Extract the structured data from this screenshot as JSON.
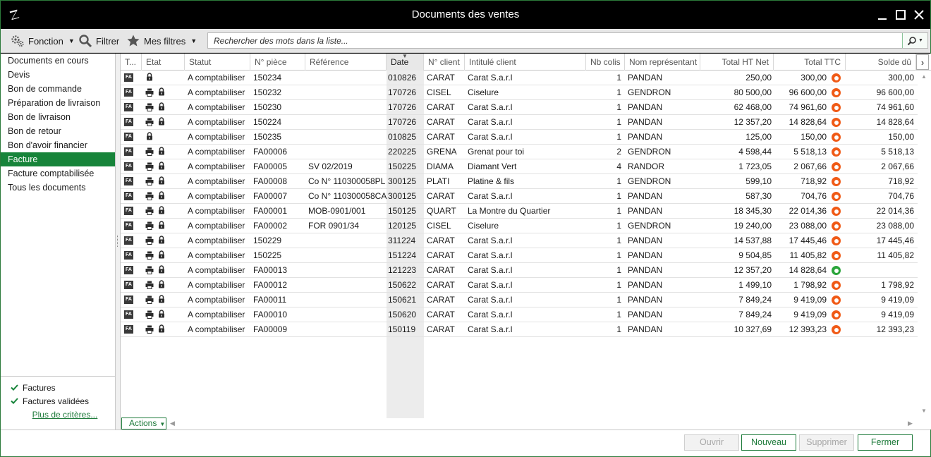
{
  "window": {
    "title": "Documents des ventes"
  },
  "toolbar": {
    "fonction_label": "Fonction",
    "filtrer_label": "Filtrer",
    "mes_filtres_label": "Mes filtres",
    "search_placeholder": "Rechercher des mots dans la liste..."
  },
  "sidebar": {
    "items": [
      {
        "label": "Documents en cours",
        "active": false
      },
      {
        "label": "Devis",
        "active": false
      },
      {
        "label": "Bon de commande",
        "active": false
      },
      {
        "label": "Préparation de livraison",
        "active": false
      },
      {
        "label": "Bon de livraison",
        "active": false
      },
      {
        "label": "Bon de retour",
        "active": false
      },
      {
        "label": "Bon d'avoir financier",
        "active": false
      },
      {
        "label": "Facture",
        "active": true
      },
      {
        "label": "Facture comptabilisée",
        "active": false
      },
      {
        "label": "Tous les documents",
        "active": false
      }
    ],
    "filters": [
      {
        "label": "Factures",
        "checked": true
      },
      {
        "label": "Factures validées",
        "checked": true
      }
    ],
    "more_criteria": "Plus de critères..."
  },
  "grid": {
    "columns": [
      "T...",
      "Etat",
      "Statut",
      "N° pièce",
      "Référence",
      "Date",
      "N° client",
      "Intitulé client",
      "Nb colis",
      "Nom représentant",
      "Total HT Net",
      "Total TTC",
      "Solde dû"
    ],
    "type_badge": "FA",
    "rows": [
      {
        "printed": false,
        "statut": "A comptabiliser",
        "piece": "150234",
        "ref": "",
        "date": "010826",
        "client": "CARAT",
        "intitule": "Carat S.a.r.l",
        "colis": "1",
        "rep": "PANDAN",
        "ht": "250,00",
        "ttc": "300,00",
        "status": "orange",
        "solde": "300,00"
      },
      {
        "printed": true,
        "statut": "A comptabiliser",
        "piece": "150232",
        "ref": "",
        "date": "170726",
        "client": "CISEL",
        "intitule": "Ciselure",
        "colis": "1",
        "rep": "GENDRON",
        "ht": "80 500,00",
        "ttc": "96 600,00",
        "status": "orange",
        "solde": "96 600,00"
      },
      {
        "printed": true,
        "statut": "A comptabiliser",
        "piece": "150230",
        "ref": "",
        "date": "170726",
        "client": "CARAT",
        "intitule": "Carat S.a.r.l",
        "colis": "1",
        "rep": "PANDAN",
        "ht": "62 468,00",
        "ttc": "74 961,60",
        "status": "orange",
        "solde": "74 961,60"
      },
      {
        "printed": true,
        "statut": "A comptabiliser",
        "piece": "150224",
        "ref": "",
        "date": "170726",
        "client": "CARAT",
        "intitule": "Carat S.a.r.l",
        "colis": "1",
        "rep": "PANDAN",
        "ht": "12 357,20",
        "ttc": "14 828,64",
        "status": "orange",
        "solde": "14 828,64"
      },
      {
        "printed": false,
        "statut": "A comptabiliser",
        "piece": "150235",
        "ref": "",
        "date": "010825",
        "client": "CARAT",
        "intitule": "Carat S.a.r.l",
        "colis": "1",
        "rep": "PANDAN",
        "ht": "125,00",
        "ttc": "150,00",
        "status": "orange",
        "solde": "150,00"
      },
      {
        "printed": true,
        "statut": "A comptabiliser",
        "piece": "FA00006",
        "ref": "",
        "date": "220225",
        "client": "GRENA",
        "intitule": "Grenat pour toi",
        "colis": "2",
        "rep": "GENDRON",
        "ht": "4 598,44",
        "ttc": "5 518,13",
        "status": "orange",
        "solde": "5 518,13"
      },
      {
        "printed": true,
        "statut": "A comptabiliser",
        "piece": "FA00005",
        "ref": "SV 02/2019",
        "date": "150225",
        "client": "DIAMA",
        "intitule": "Diamant Vert",
        "colis": "4",
        "rep": "RANDOR",
        "ht": "1 723,05",
        "ttc": "2 067,66",
        "status": "orange",
        "solde": "2 067,66"
      },
      {
        "printed": true,
        "statut": "A comptabiliser",
        "piece": "FA00008",
        "ref": "Co N° 110300058PL",
        "date": "300125",
        "client": "PLATI",
        "intitule": "Platine & fils",
        "colis": "1",
        "rep": "GENDRON",
        "ht": "599,10",
        "ttc": "718,92",
        "status": "orange",
        "solde": "718,92"
      },
      {
        "printed": true,
        "statut": "A comptabiliser",
        "piece": "FA00007",
        "ref": "Co N° 110300058CA",
        "date": "300125",
        "client": "CARAT",
        "intitule": "Carat S.a.r.l",
        "colis": "1",
        "rep": "PANDAN",
        "ht": "587,30",
        "ttc": "704,76",
        "status": "orange",
        "solde": "704,76"
      },
      {
        "printed": true,
        "statut": "A comptabiliser",
        "piece": "FA00001",
        "ref": "MOB-0901/001",
        "date": "150125",
        "client": "QUART",
        "intitule": "La Montre du Quartier",
        "colis": "1",
        "rep": "PANDAN",
        "ht": "18 345,30",
        "ttc": "22 014,36",
        "status": "orange",
        "solde": "22 014,36"
      },
      {
        "printed": true,
        "statut": "A comptabiliser",
        "piece": "FA00002",
        "ref": "FOR 0901/34",
        "date": "120125",
        "client": "CISEL",
        "intitule": "Ciselure",
        "colis": "1",
        "rep": "GENDRON",
        "ht": "19 240,00",
        "ttc": "23 088,00",
        "status": "orange",
        "solde": "23 088,00"
      },
      {
        "printed": true,
        "statut": "A comptabiliser",
        "piece": "150229",
        "ref": "",
        "date": "311224",
        "client": "CARAT",
        "intitule": "Carat S.a.r.l",
        "colis": "1",
        "rep": "PANDAN",
        "ht": "14 537,88",
        "ttc": "17 445,46",
        "status": "orange",
        "solde": "17 445,46"
      },
      {
        "printed": true,
        "statut": "A comptabiliser",
        "piece": "150225",
        "ref": "",
        "date": "151224",
        "client": "CARAT",
        "intitule": "Carat S.a.r.l",
        "colis": "1",
        "rep": "PANDAN",
        "ht": "9 504,85",
        "ttc": "11 405,82",
        "status": "orange",
        "solde": "11 405,82"
      },
      {
        "printed": true,
        "statut": "A comptabiliser",
        "piece": "FA00013",
        "ref": "",
        "date": "121223",
        "client": "CARAT",
        "intitule": "Carat S.a.r.l",
        "colis": "1",
        "rep": "PANDAN",
        "ht": "12 357,20",
        "ttc": "14 828,64",
        "status": "green",
        "solde": ""
      },
      {
        "printed": true,
        "statut": "A comptabiliser",
        "piece": "FA00012",
        "ref": "",
        "date": "150622",
        "client": "CARAT",
        "intitule": "Carat S.a.r.l",
        "colis": "1",
        "rep": "PANDAN",
        "ht": "1 499,10",
        "ttc": "1 798,92",
        "status": "orange",
        "solde": "1 798,92"
      },
      {
        "printed": true,
        "statut": "A comptabiliser",
        "piece": "FA00011",
        "ref": "",
        "date": "150621",
        "client": "CARAT",
        "intitule": "Carat S.a.r.l",
        "colis": "1",
        "rep": "PANDAN",
        "ht": "7 849,24",
        "ttc": "9 419,09",
        "status": "orange",
        "solde": "9 419,09"
      },
      {
        "printed": true,
        "statut": "A comptabiliser",
        "piece": "FA00010",
        "ref": "",
        "date": "150620",
        "client": "CARAT",
        "intitule": "Carat S.a.r.l",
        "colis": "1",
        "rep": "PANDAN",
        "ht": "7 849,24",
        "ttc": "9 419,09",
        "status": "orange",
        "solde": "9 419,09"
      },
      {
        "printed": true,
        "statut": "A comptabiliser",
        "piece": "FA00009",
        "ref": "",
        "date": "150119",
        "client": "CARAT",
        "intitule": "Carat S.a.r.l",
        "colis": "1",
        "rep": "PANDAN",
        "ht": "10 327,69",
        "ttc": "12 393,23",
        "status": "orange",
        "solde": "12 393,23"
      }
    ],
    "actions_label": "Actions"
  },
  "buttons": {
    "ouvrir": "Ouvrir",
    "nouveau": "Nouveau",
    "supprimer": "Supprimer",
    "fermer": "Fermer"
  },
  "colors": {
    "accent": "#17843a",
    "status_orange": "#f05a16",
    "status_green": "#2aa53a"
  },
  "icons": {
    "app": "bag-icon",
    "fonction": "gears-icon",
    "filtrer": "magnifier-icon",
    "mes_filtres": "star-icon",
    "etat_lock": "lock-icon",
    "etat_print": "printer-icon",
    "search": "search-icon"
  }
}
